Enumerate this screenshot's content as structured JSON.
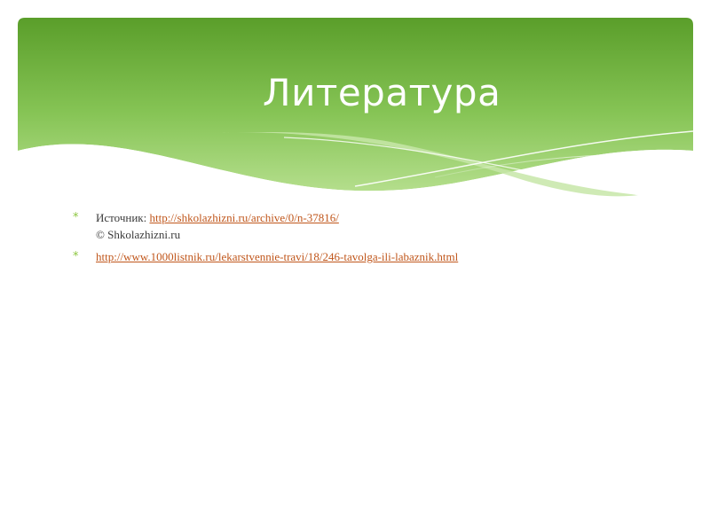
{
  "slide": {
    "title": "Литература",
    "items": [
      {
        "prefix": "Источник: ",
        "link": "http://shkolazhizni.ru/archive/0/n-37816/",
        "second_line": "© Shkolazhizni.ru"
      },
      {
        "prefix": "",
        "link": "http://www.1000listnik.ru/lekarstvennie-travi/18/246-tavolga-ili-labaznik.html",
        "second_line": ""
      }
    ],
    "bullet_glyph": "*"
  },
  "colors": {
    "header_top": "#5fa12e",
    "header_bottom": "#a9d87a",
    "bullet": "#8cc63f",
    "link": "#c0561b",
    "text": "#3a3a3a"
  }
}
